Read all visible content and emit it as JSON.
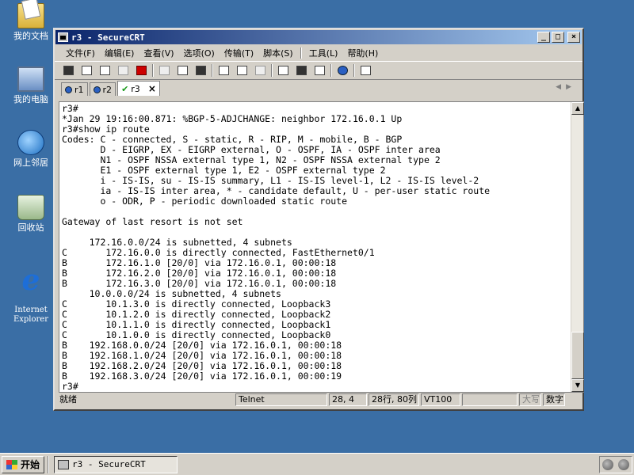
{
  "desktop": {
    "icons": [
      {
        "label": "我的文档"
      },
      {
        "label": "我的电脑"
      },
      {
        "label": "网上邻居"
      },
      {
        "label": "回收站"
      },
      {
        "label": "Internet\nExplorer"
      }
    ]
  },
  "window": {
    "title": "r3 - SecureCRT",
    "buttons": {
      "minimize": "_",
      "maximize": "□",
      "close": "×"
    }
  },
  "menu": {
    "items": [
      "文件(F)",
      "编辑(E)",
      "查看(V)",
      "选项(O)",
      "传输(T)",
      "脚本(S)",
      "工具(L)",
      "帮助(H)"
    ]
  },
  "tabs": [
    {
      "label": "r1"
    },
    {
      "label": "r2"
    },
    {
      "label": "r3",
      "close": "×"
    }
  ],
  "terminal": {
    "lines": [
      "r3#",
      "*Jan 29 19:16:00.871: %BGP-5-ADJCHANGE: neighbor 172.16.0.1 Up",
      "r3#show ip route",
      "Codes: C - connected, S - static, R - RIP, M - mobile, B - BGP",
      "       D - EIGRP, EX - EIGRP external, O - OSPF, IA - OSPF inter area",
      "       N1 - OSPF NSSA external type 1, N2 - OSPF NSSA external type 2",
      "       E1 - OSPF external type 1, E2 - OSPF external type 2",
      "       i - IS-IS, su - IS-IS summary, L1 - IS-IS level-1, L2 - IS-IS level-2",
      "       ia - IS-IS inter area, * - candidate default, U - per-user static route",
      "       o - ODR, P - periodic downloaded static route",
      "",
      "Gateway of last resort is not set",
      "",
      "     172.16.0.0/24 is subnetted, 4 subnets",
      "C       172.16.0.0 is directly connected, FastEthernet0/1",
      "B       172.16.1.0 [20/0] via 172.16.0.1, 00:00:18",
      "B       172.16.2.0 [20/0] via 172.16.0.1, 00:00:18",
      "B       172.16.3.0 [20/0] via 172.16.0.1, 00:00:18",
      "     10.0.0.0/24 is subnetted, 4 subnets",
      "C       10.1.3.0 is directly connected, Loopback3",
      "C       10.1.2.0 is directly connected, Loopback2",
      "C       10.1.1.0 is directly connected, Loopback1",
      "C       10.1.0.0 is directly connected, Loopback0",
      "B    192.168.0.0/24 [20/0] via 172.16.0.1, 00:00:18",
      "B    192.168.1.0/24 [20/0] via 172.16.0.1, 00:00:18",
      "B    192.168.2.0/24 [20/0] via 172.16.0.1, 00:00:18",
      "B    192.168.3.0/24 [20/0] via 172.16.0.1, 00:00:19",
      "r3#"
    ]
  },
  "statusbar": {
    "ready": "就绪",
    "protocol": "Telnet",
    "cursor": "28,  4",
    "size": "28行, 80列",
    "emulation": "VT100",
    "caps": "大写",
    "num": "数字"
  },
  "taskbar": {
    "start": "开始",
    "task": "r3 - SecureCRT"
  }
}
